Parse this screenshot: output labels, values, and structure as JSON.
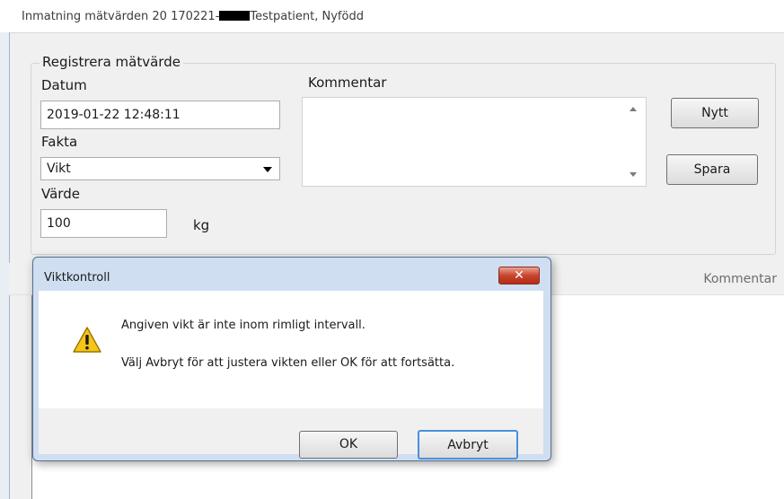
{
  "window": {
    "title_prefix": "Inmatning mätvärden 20 170221-",
    "title_suffix": "Testpatient, Nyfödd"
  },
  "form": {
    "group_label": "Registrera mätvärde",
    "datum_label": "Datum",
    "datum_value": "2019-01-22 12:48:11",
    "fakta_label": "Fakta",
    "fakta_value": "Vikt",
    "varde_label": "Värde",
    "varde_value": "100",
    "unit": "kg",
    "kommentar_label": "Kommentar",
    "kommentar_value": "",
    "nytt_button": "Nytt",
    "spara_button": "Spara"
  },
  "grid": {
    "column_kommentar": "Kommentar"
  },
  "dialog": {
    "title": "Viktkontroll",
    "close_icon": "close-icon",
    "warning_icon": "warning-icon",
    "message_line1": "Angiven vikt är inte inom rimligt intervall.",
    "message_line2": "Välj Avbryt för att justera vikten eller OK för att fortsätta.",
    "ok_button": "OK",
    "cancel_button": "Avbryt"
  }
}
